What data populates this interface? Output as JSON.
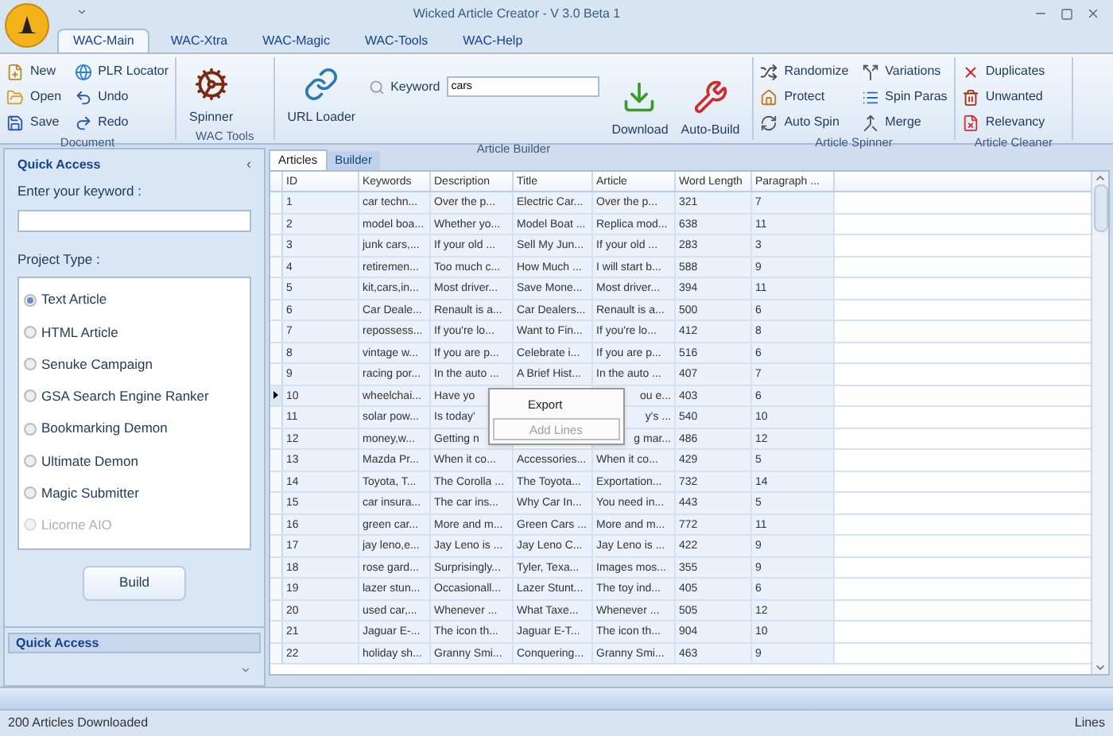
{
  "window": {
    "title": "Wicked Article Creator - V 3.0 Beta 1"
  },
  "ribbon_tabs": [
    {
      "label": "WAC-Main",
      "selected": true
    },
    {
      "label": "WAC-Xtra",
      "selected": false
    },
    {
      "label": "WAC-Magic",
      "selected": false
    },
    {
      "label": "WAC-Tools",
      "selected": false
    },
    {
      "label": "WAC-Help",
      "selected": false
    }
  ],
  "ribbon_groups": [
    {
      "title": "Document",
      "kind": "small",
      "items": [
        {
          "label": "New"
        },
        {
          "label": "Open"
        },
        {
          "label": "Save"
        },
        {
          "label": "PLR Locator"
        },
        {
          "label": "Undo"
        },
        {
          "label": "Redo"
        }
      ]
    },
    {
      "title": "WAC Tools",
      "kind": "large",
      "items": [
        {
          "label": "Spinner"
        }
      ]
    },
    {
      "title": "Article Builder",
      "kind": "builder",
      "items": [
        {
          "label": "URL Loader"
        },
        {
          "label": "Download"
        },
        {
          "label": "Auto-Build"
        }
      ],
      "keyword": {
        "label": "Keyword",
        "value": "cars"
      }
    },
    {
      "title": "Article Spinner",
      "kind": "small",
      "items": [
        {
          "label": "Randomize"
        },
        {
          "label": "Protect"
        },
        {
          "label": "Auto Spin"
        },
        {
          "label": "Variations"
        },
        {
          "label": "Spin Paras"
        },
        {
          "label": "Merge"
        }
      ]
    },
    {
      "title": "Article Cleaner",
      "kind": "small",
      "items": [
        {
          "label": "Duplicates"
        },
        {
          "label": "Unwanted"
        },
        {
          "label": "Relevancy"
        }
      ]
    }
  ],
  "quick_access": {
    "title": "Quick Access",
    "collapse": "‹",
    "keyword_label": "Enter your keyword :",
    "project_type_label": "Project Type :",
    "project_types": [
      {
        "label": "Text Article",
        "selected": true,
        "disabled": false
      },
      {
        "label": "HTML Article",
        "selected": false,
        "disabled": false
      },
      {
        "label": "Senuke Campaign",
        "selected": false,
        "disabled": false
      },
      {
        "label": "GSA Search Engine Ranker",
        "selected": false,
        "disabled": false
      },
      {
        "label": "Bookmarking Demon",
        "selected": false,
        "disabled": false
      },
      {
        "label": "Ultimate Demon",
        "selected": false,
        "disabled": false
      },
      {
        "label": "Magic Submitter",
        "selected": false,
        "disabled": false
      },
      {
        "label": "Licorne AIO",
        "selected": false,
        "disabled": true
      }
    ],
    "build_button": "Build",
    "footer_title": "Quick Access"
  },
  "content_tabs": [
    {
      "label": "Articles",
      "selected": true
    },
    {
      "label": "Builder",
      "selected": false
    }
  ],
  "table": {
    "columns": [
      "ID",
      "Keywords",
      "Description",
      "Title",
      "Article",
      "Word Length",
      "Paragraph ..."
    ],
    "rows": [
      {
        "selected": false,
        "cells": [
          "1",
          "car techn...",
          "Over the p...",
          "Electric Car...",
          "Over the p...",
          "321",
          "7"
        ]
      },
      {
        "selected": false,
        "cells": [
          "2",
          "model boa...",
          "Whether yo...",
          "Model Boat ...",
          "Replica mod...",
          "638",
          "11"
        ]
      },
      {
        "selected": false,
        "cells": [
          "3",
          "junk cars,...",
          "If your old ...",
          "Sell My Jun...",
          "If your old ...",
          "283",
          "3"
        ]
      },
      {
        "selected": false,
        "cells": [
          "4",
          "retiremen...",
          "Too much c...",
          "How Much ...",
          "I will start b...",
          "588",
          "9"
        ]
      },
      {
        "selected": false,
        "cells": [
          "5",
          "kit,cars,in...",
          "Most driver...",
          "Save Mone...",
          "Most driver...",
          "394",
          "11"
        ]
      },
      {
        "selected": false,
        "cells": [
          "6",
          "Car Deale...",
          "Renault is a...",
          "Car Dealers...",
          "Renault is a...",
          "500",
          "6"
        ]
      },
      {
        "selected": false,
        "cells": [
          "7",
          "repossess...",
          "If you're lo...",
          "Want to Fin...",
          "If you're lo...",
          "412",
          "8"
        ]
      },
      {
        "selected": false,
        "cells": [
          "8",
          "vintage w...",
          "If you are p...",
          "Celebrate i...",
          "If you are p...",
          "516",
          "6"
        ]
      },
      {
        "selected": false,
        "cells": [
          "9",
          "racing por...",
          "In the auto ...",
          "A Brief Hist...",
          "In the auto ...",
          "407",
          "7"
        ]
      },
      {
        "selected": true,
        "cells": [
          "10",
          "wheelchai...",
          "Have yo",
          null,
          "ou e...",
          "403",
          "6"
        ]
      },
      {
        "selected": false,
        "cells": [
          "11",
          "solar pow...",
          "Is today'",
          null,
          "y's ...",
          "540",
          "10"
        ]
      },
      {
        "selected": false,
        "cells": [
          "12",
          "money,w...",
          "Getting n",
          null,
          "g mar...",
          "486",
          "12"
        ]
      },
      {
        "selected": false,
        "cells": [
          "13",
          "Mazda Pr...",
          "When it co...",
          "Accessories...",
          "When it co...",
          "429",
          "5"
        ]
      },
      {
        "selected": false,
        "cells": [
          "14",
          "Toyota, T...",
          "The Corolla ...",
          "The Toyota...",
          "Exportation...",
          "732",
          "14"
        ]
      },
      {
        "selected": false,
        "cells": [
          "15",
          "car insura...",
          "The car ins...",
          "Why Car In...",
          "You need in...",
          "443",
          "5"
        ]
      },
      {
        "selected": false,
        "cells": [
          "16",
          "green car...",
          "More and m...",
          "Green Cars ...",
          "More and m...",
          "772",
          "11"
        ]
      },
      {
        "selected": false,
        "cells": [
          "17",
          "jay leno,e...",
          "Jay Leno is ...",
          "Jay Leno C...",
          "Jay Leno is ...",
          "422",
          "9"
        ]
      },
      {
        "selected": false,
        "cells": [
          "18",
          "rose gard...",
          "Surprisingly...",
          "Tyler, Texa...",
          "Images mos...",
          "355",
          "9"
        ]
      },
      {
        "selected": false,
        "cells": [
          "19",
          "lazer stun...",
          "Occasionall...",
          "Lazer Stunt...",
          "The toy ind...",
          "405",
          "6"
        ]
      },
      {
        "selected": false,
        "cells": [
          "20",
          "used car,...",
          "Whenever ...",
          "What Taxe...",
          "Whenever ...",
          "505",
          "12"
        ]
      },
      {
        "selected": false,
        "cells": [
          "21",
          "Jaguar E-...",
          "The icon th...",
          "Jaguar E-T...",
          "The icon th...",
          "904",
          "10"
        ]
      },
      {
        "selected": false,
        "cells": [
          "22",
          "holiday sh...",
          "Granny Smi...",
          "Conquering...",
          "Granny Smi...",
          "463",
          "9"
        ]
      }
    ]
  },
  "context_menu": [
    {
      "label": "Export",
      "disabled": false
    },
    {
      "label": "Add Lines",
      "disabled": true
    }
  ],
  "status_bar": {
    "left": "200 Articles Downloaded",
    "right": "Lines"
  }
}
